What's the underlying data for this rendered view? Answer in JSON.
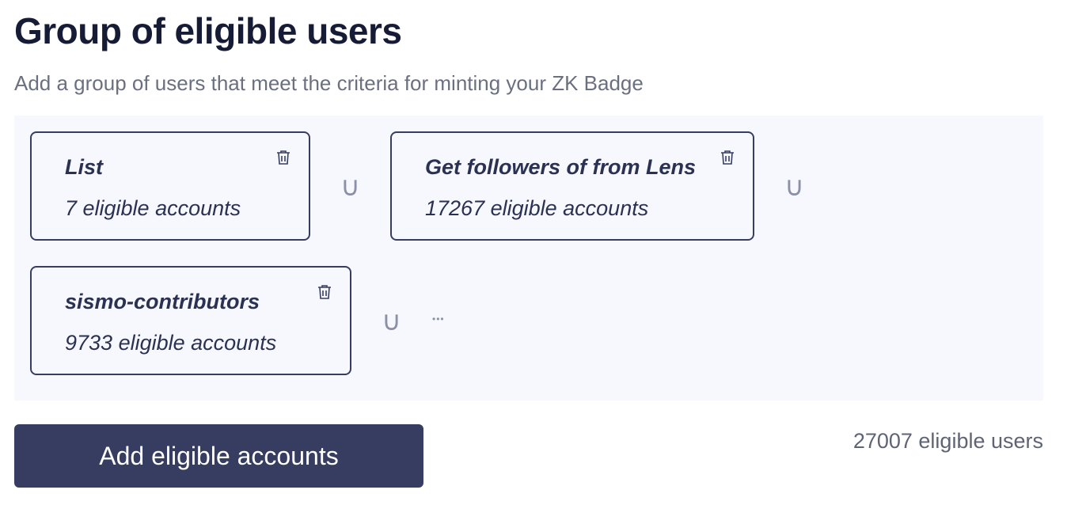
{
  "header": {
    "title": "Group of eligible users",
    "subtitle": "Add a group of users that meet the criteria for minting your ZK Badge"
  },
  "groups": [
    {
      "name": "List",
      "count_label": "7 eligible accounts"
    },
    {
      "name": "Get followers of from Lens",
      "count_label": "17267 eligible accounts"
    },
    {
      "name": "sismo-contributors",
      "count_label": "9733 eligible accounts"
    }
  ],
  "union_symbol": "∪",
  "more_symbol": "•••",
  "footer": {
    "add_button_label": "Add eligible accounts",
    "total_label": "27007 eligible users"
  },
  "colors": {
    "primary": "#363d61",
    "panel_bg": "#f7f8fd",
    "title": "#161c36",
    "muted": "#6b7080"
  },
  "icons": {
    "delete": "trash-icon"
  }
}
